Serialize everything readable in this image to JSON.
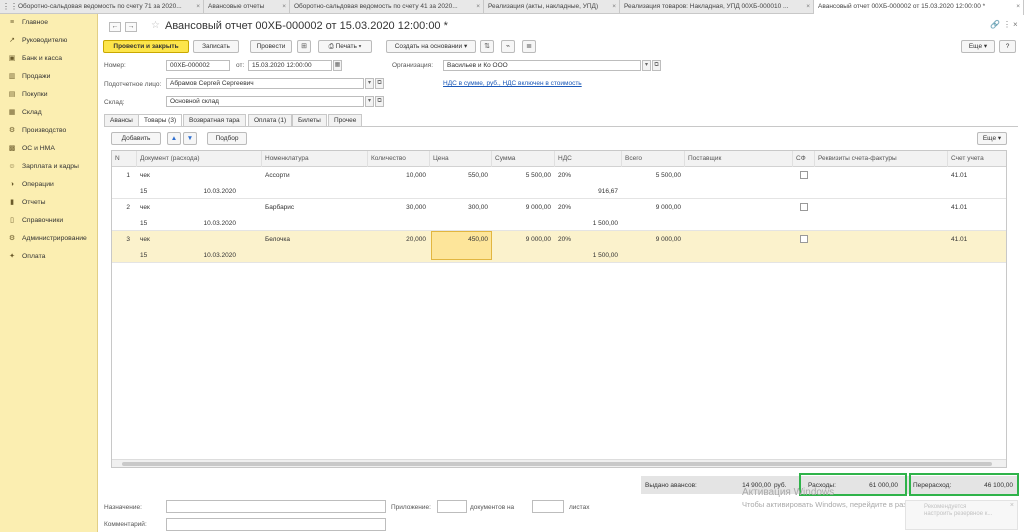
{
  "tabs": [
    {
      "label": "Оборотно-сальдовая ведомость по счету 71 за 2020..."
    },
    {
      "label": "Авансовые отчеты"
    },
    {
      "label": "Оборотно-сальдовая ведомость по счету 41 за 2020..."
    },
    {
      "label": "Реализация (акты, накладные, УПД)"
    },
    {
      "label": "Реализация товаров: Накладная, УПД 00ХБ-000010 ..."
    },
    {
      "label": "Авансовый отчет 00ХБ-000002 от 15.03.2020 12:00:00 *"
    }
  ],
  "sidebar": {
    "items": [
      {
        "label": "Главное",
        "icon": "≡"
      },
      {
        "label": "Руководителю",
        "icon": "↗"
      },
      {
        "label": "Банк и касса",
        "icon": "▣"
      },
      {
        "label": "Продажи",
        "icon": "▥"
      },
      {
        "label": "Покупки",
        "icon": "▤"
      },
      {
        "label": "Склад",
        "icon": "▦"
      },
      {
        "label": "Производство",
        "icon": "⚙"
      },
      {
        "label": "ОС и НМА",
        "icon": "▩"
      },
      {
        "label": "Зарплата и кадры",
        "icon": "☺"
      },
      {
        "label": "Операции",
        "icon": "◑"
      },
      {
        "label": "Отчеты",
        "icon": "▮"
      },
      {
        "label": "Справочники",
        "icon": "▯"
      },
      {
        "label": "Администрирование",
        "icon": "⚙"
      },
      {
        "label": "Оплата",
        "icon": "✦"
      }
    ]
  },
  "document": {
    "title": "Авансовый отчет 00ХБ-000002 от 15.03.2020 12:00:00 *",
    "link_icon": "🔗",
    "more_icon": "⋮",
    "close_icon": "×"
  },
  "toolbar": {
    "post_close": "Провести и закрыть",
    "save": "Записать",
    "post": "Провести",
    "print": "Печать",
    "create_based": "Создать на основании",
    "more": "Еще"
  },
  "form": {
    "number_label": "Номер:",
    "number_value": "00ХБ-000002",
    "date_label": "от:",
    "date_value": "15.03.2020 12:00:00",
    "org_label": "Организация:",
    "org_value": "Васильев и Ко ООО",
    "person_label": "Подотчетное лицо:",
    "person_value": "Абрамов Сергей Сергеевич",
    "vat_link": "НДС в сумме, руб., НДС включен в стоимость",
    "warehouse_label": "Склад:",
    "warehouse_value": "Основной склад"
  },
  "inner_tabs": [
    {
      "label": "Авансы"
    },
    {
      "label": "Товары (3)"
    },
    {
      "label": "Возвратная тара"
    },
    {
      "label": "Оплата (1)"
    },
    {
      "label": "Билеты"
    },
    {
      "label": "Прочее"
    }
  ],
  "table_toolbar": {
    "add": "Добавить",
    "selection": "Подбор",
    "more": "Еще"
  },
  "table": {
    "columns": [
      "N",
      "Документ (расхода)",
      "Номенклатура",
      "Количество",
      "Цена",
      "Сумма",
      "НДС",
      "Всего",
      "Поставщик",
      "СФ",
      "Реквизиты счета-фактуры",
      "Счет учета"
    ],
    "rows": [
      {
        "n": "1",
        "doc": "чек",
        "doc_no": "15",
        "doc_date": "10.03.2020",
        "item": "Ассорти",
        "qty": "10,000",
        "price": "550,00",
        "sum": "5 500,00",
        "vat_rate": "20%",
        "vat_sum": "916,67",
        "total": "5 500,00",
        "account": "41.01"
      },
      {
        "n": "2",
        "doc": "чек",
        "doc_no": "15",
        "doc_date": "10.03.2020",
        "item": "Барбарис",
        "qty": "30,000",
        "price": "300,00",
        "sum": "9 000,00",
        "vat_rate": "20%",
        "vat_sum": "1 500,00",
        "total": "9 000,00",
        "account": "41.01"
      },
      {
        "n": "3",
        "doc": "чек",
        "doc_no": "15",
        "doc_date": "10.03.2020",
        "item": "Белочка",
        "qty": "20,000",
        "price": "450,00",
        "sum": "9 000,00",
        "vat_rate": "20%",
        "vat_sum": "1 500,00",
        "total": "9 000,00",
        "account": "41.01"
      }
    ]
  },
  "totals": {
    "advances_label": "Выдано авансов:",
    "advances_value": "14 900,00",
    "advances_unit": "руб.",
    "expenses_label": "Расходы:",
    "expenses_value": "61 000,00",
    "overrun_label": "Перерасход:",
    "overrun_value": "46 100,00"
  },
  "footer": {
    "purpose_label": "Назначение:",
    "attachment_label": "Приложение:",
    "documents_on": "документов на",
    "sheets": "листах",
    "comment_label": "Комментарий:"
  },
  "watermark": {
    "line1": "Активация Windows",
    "line2": "Чтобы активировать Windows, перейдите в раздел \"Параметры\"."
  },
  "notification": {
    "line1": "Рекомендуется",
    "line2": "настроить резервное к..."
  },
  "colors": {
    "sidebar_bg": "#fbeeb1",
    "primary_button": "#fde54a",
    "highlight_border": "#2fb34a",
    "selected_row": "#fbf2cc",
    "link": "#1a58b8"
  }
}
